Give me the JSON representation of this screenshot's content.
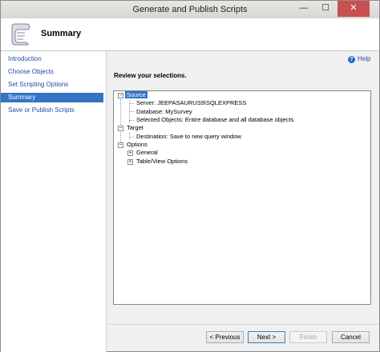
{
  "window": {
    "title": "Generate and Publish Scripts"
  },
  "header": {
    "title": "Summary",
    "logo_icon": "scroll-icon"
  },
  "sidebar": {
    "items": [
      {
        "label": "Introduction",
        "active": false
      },
      {
        "label": "Choose Objects",
        "active": false
      },
      {
        "label": "Set Scripting Options",
        "active": false
      },
      {
        "label": "Summary",
        "active": true
      },
      {
        "label": "Save or Publish Scripts",
        "active": false
      }
    ]
  },
  "help": {
    "label": "Help",
    "icon": "help-icon"
  },
  "main": {
    "instruction": "Review your selections.",
    "tree": {
      "source": {
        "label": "Source",
        "server": "Server: JEEPASAURUS9\\SQLEXPRESS",
        "database": "Database: MySurvey",
        "objects": "Selected Objects: Entire database and all database objects"
      },
      "target": {
        "label": "Target",
        "destination": "Destination: Save to new query window"
      },
      "options": {
        "label": "Options",
        "general": "General",
        "table_view": "Table/View Options"
      }
    }
  },
  "buttons": {
    "previous": "< Previous",
    "next": "Next >",
    "finish": "Finish",
    "cancel": "Cancel"
  },
  "titlebar_buttons": {
    "minimize": "—",
    "maximize": "☐",
    "close": "✕"
  }
}
